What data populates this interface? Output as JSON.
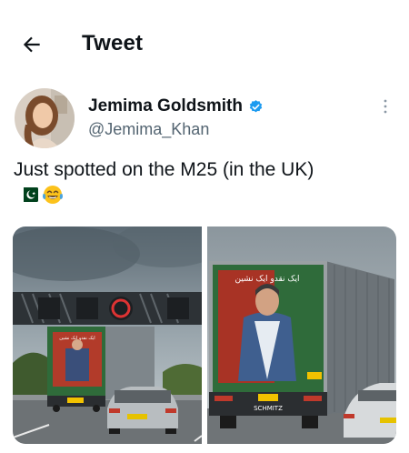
{
  "header": {
    "title": "Tweet"
  },
  "author": {
    "name": "Jemima Goldsmith",
    "handle": "@Jemima_Khan"
  },
  "tweet": {
    "text": "Just spotted on the M25 (in the UK)",
    "emojis": [
      "pakistan-flag",
      "tears-of-joy-face"
    ]
  },
  "media": {
    "photo_left": {
      "trailer_banner_text": "ایک نقدو ایک نشین"
    },
    "photo_right": {
      "trailer_banner_text": "ایک نقدو ایک نشین",
      "trailer_brand": "SCHMITZ"
    }
  },
  "colors": {
    "accent": "#1d9bf0",
    "secondary_text": "#536471",
    "text": "#0f1419"
  }
}
